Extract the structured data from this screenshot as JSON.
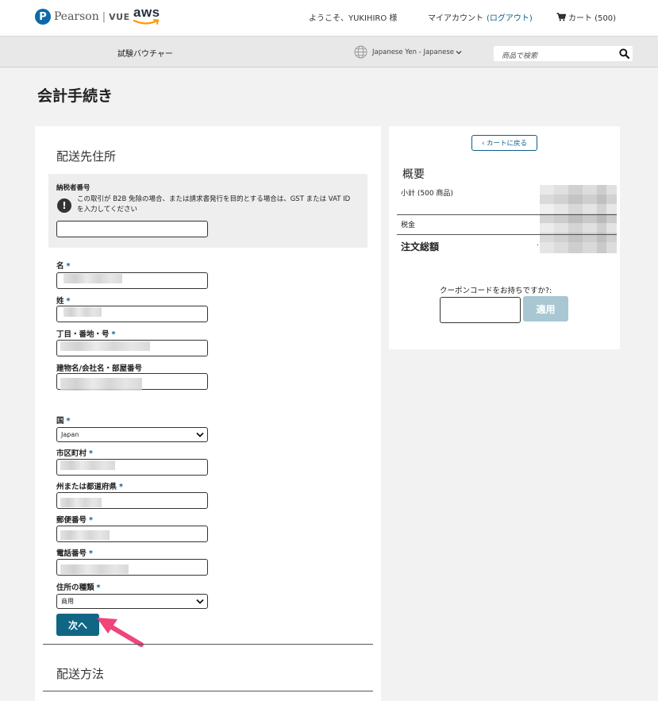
{
  "header": {
    "brand_pearson": "Pearson",
    "brand_sep": "|",
    "brand_vue": "VUE",
    "brand_aws": "aws",
    "welcome": "ようこそ、YUKIHIRO 様",
    "account": "マイアカウント",
    "logout": "(ログアウト)",
    "cart": "カート (500)"
  },
  "subnav": {
    "voucher": "試験バウチャー",
    "currency_language": "Japanese Yen - Japanese",
    "search_placeholder": "商品で検索"
  },
  "page": {
    "title": "会計手続き"
  },
  "shipping_address": {
    "section_title": "配送先住所",
    "tax_id_label": "納税者番号",
    "tax_id_note": "この取引が B2B 免除の場合、または請求書発行を目的とする場合は、GST または VAT ID を入力してください",
    "required_mark": "*",
    "fields": {
      "first_name": "名",
      "last_name": "姓",
      "street": "丁目・番地・号",
      "building": "建物名/会社名・部屋番号",
      "country": "国",
      "city": "市区町村",
      "state": "州または都道府県",
      "postal": "郵便番号",
      "phone": "電話番号",
      "address_type": "住所の種類"
    },
    "country_value": "Japan",
    "address_type_value": "商用",
    "next_button": "次へ"
  },
  "shipping_method": {
    "section_title": "配送方法"
  },
  "summary": {
    "back_to_cart": "‹ カートに戻る",
    "title": "概要",
    "subtotal": "小計 (500 商品)",
    "tax": "税金",
    "total": "注文総額",
    "total_prefix": ".",
    "coupon_prompt": "クーポンコードをお持ちですか?:",
    "apply_button": "適用"
  },
  "colors": {
    "primary": "#106685",
    "link": "#0d5e8a",
    "apply_disabled": "#a9c7d3",
    "annotation_arrow": "#f0447a"
  },
  "icons": [
    "pearson-logo-icon",
    "aws-logo-icon",
    "cart-icon",
    "globe-icon",
    "chevron-down-icon",
    "search-icon",
    "alert-icon",
    "annotation-arrow-icon"
  ]
}
